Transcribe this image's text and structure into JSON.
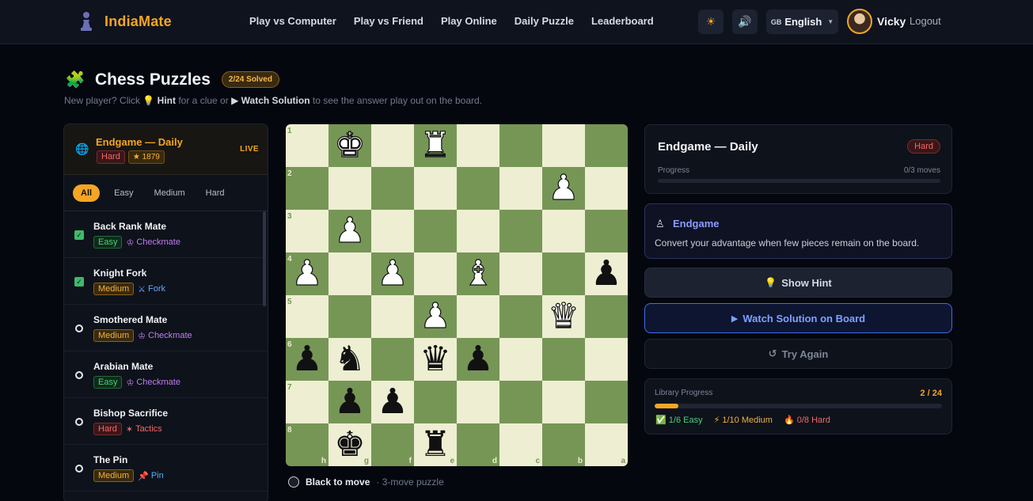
{
  "app": {
    "name": "IndiaMate",
    "nav": [
      "Play vs Computer",
      "Play vs Friend",
      "Play Online",
      "Daily Puzzle",
      "Leaderboard"
    ],
    "theme_icon": "☀",
    "sound_icon": "🔊",
    "language_flag": "GB",
    "language": "English",
    "user": "Vicky",
    "logout": "Logout"
  },
  "page": {
    "title": "Chess Puzzles",
    "solved_badge": "2/24 Solved",
    "subtitle_prefix": "New player? Click",
    "hint_word": "Hint",
    "subtitle_mid": "for a clue or",
    "watch_word": "Watch Solution",
    "subtitle_suffix": "to see the answer play out on the board."
  },
  "sidebar": {
    "featured": {
      "title": "Endgame — Daily",
      "difficulty": "Hard",
      "rating": "★ 1879",
      "live": "LIVE"
    },
    "filters": [
      "All",
      "Easy",
      "Medium",
      "Hard"
    ],
    "puzzles": [
      {
        "title": "Back Rank Mate",
        "difficulty": "Easy",
        "theme": "Checkmate",
        "theme_icon": "♔",
        "theme_class": "checkmate",
        "solved": true
      },
      {
        "title": "Knight Fork",
        "difficulty": "Medium",
        "theme": "Fork",
        "theme_icon": "⚔",
        "theme_class": "fork",
        "solved": true
      },
      {
        "title": "Smothered Mate",
        "difficulty": "Medium",
        "theme": "Checkmate",
        "theme_icon": "♔",
        "theme_class": "checkmate",
        "solved": false
      },
      {
        "title": "Arabian Mate",
        "difficulty": "Easy",
        "theme": "Checkmate",
        "theme_icon": "♔",
        "theme_class": "checkmate",
        "solved": false
      },
      {
        "title": "Bishop Sacrifice",
        "difficulty": "Hard",
        "theme": "Tactics",
        "theme_icon": "✶",
        "theme_class": "tactics",
        "solved": false
      },
      {
        "title": "The Pin",
        "difficulty": "Medium",
        "theme": "Pin",
        "theme_icon": "📌",
        "theme_class": "pin",
        "solved": false
      }
    ]
  },
  "board": {
    "ranks": [
      "1",
      "2",
      "3",
      "4",
      "5",
      "6",
      "7",
      "8"
    ],
    "files": [
      "h",
      "g",
      "f",
      "e",
      "d",
      "c",
      "b",
      "a"
    ],
    "rows": [
      [
        "",
        "wK",
        "",
        "wR",
        "",
        "",
        "",
        ""
      ],
      [
        "",
        "",
        "",
        "",
        "",
        "",
        "wP",
        ""
      ],
      [
        "",
        "wP",
        "",
        "",
        "",
        "",
        "",
        ""
      ],
      [
        "wP",
        "",
        "wP",
        "",
        "wB",
        "",
        "",
        "bP"
      ],
      [
        "",
        "",
        "",
        "wP",
        "",
        "",
        "wQ",
        ""
      ],
      [
        "bP",
        "bN",
        "",
        "bQ",
        "bP",
        "",
        "",
        ""
      ],
      [
        "",
        "bP",
        "bP",
        "",
        "",
        "",
        "",
        ""
      ],
      [
        "",
        "bK",
        "",
        "bR",
        "",
        "",
        "",
        ""
      ]
    ],
    "to_move": "Black to move",
    "move_info": "· 3-move puzzle"
  },
  "panel": {
    "title": "Endgame — Daily",
    "difficulty": "Hard",
    "progress_label": "Progress",
    "progress_value": "0/3 moves",
    "theme_icon": "♙",
    "theme_title": "Endgame",
    "theme_desc": "Convert your advantage when few pieces remain on the board.",
    "hint_icon": "💡",
    "hint_label": "Show Hint",
    "watch_icon": "▶",
    "watch_label": "Watch Solution on Board",
    "retry_icon": "↺",
    "retry_label": "Try Again",
    "library_label": "Library Progress",
    "library_value": "2 / 24",
    "library_fraction": 0.083,
    "stats": [
      {
        "icon": "✅",
        "text": "1/6 Easy",
        "cls": "stat-easy"
      },
      {
        "icon": "⚡",
        "text": "1/10 Medium",
        "cls": "stat-medium"
      },
      {
        "icon": "🔥",
        "text": "0/8 Hard",
        "cls": "stat-hard"
      }
    ]
  },
  "colors": {
    "accent": "#f5a623",
    "board_light": "#eeeed2",
    "board_dark": "#769656",
    "watch_blue": "#3e6df0"
  }
}
